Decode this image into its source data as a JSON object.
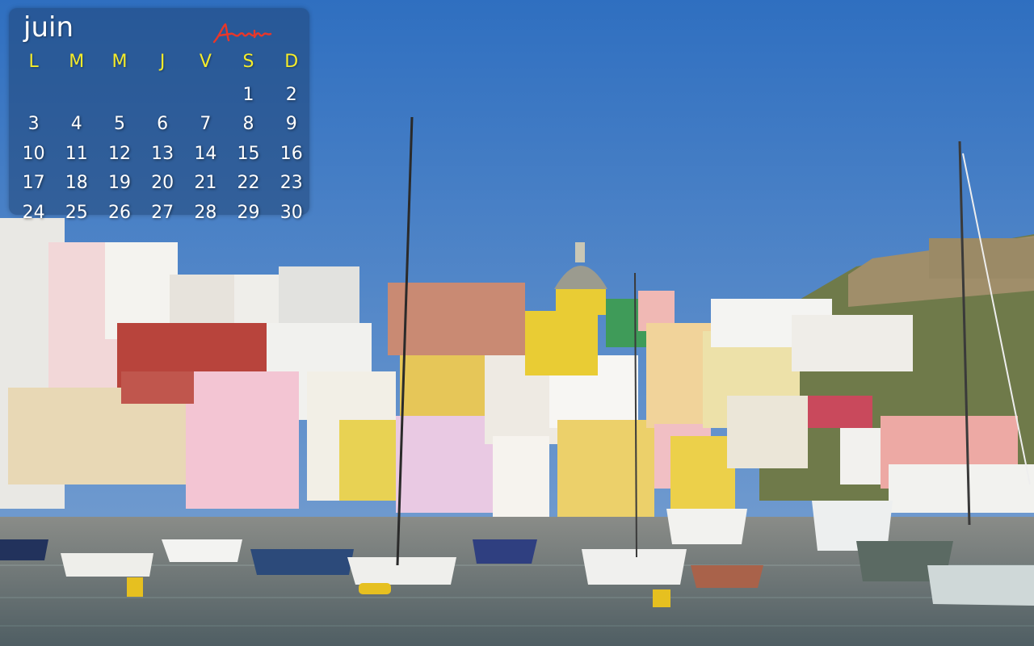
{
  "calendar": {
    "month": "juin",
    "signature": "Antoine",
    "weekdays": [
      "L",
      "M",
      "M",
      "J",
      "V",
      "S",
      "D"
    ],
    "weeks": [
      [
        "",
        "",
        "",
        "",
        "",
        "1",
        "2"
      ],
      [
        "3",
        "4",
        "5",
        "6",
        "7",
        "8",
        "9"
      ],
      [
        "10",
        "11",
        "12",
        "13",
        "14",
        "15",
        "16"
      ],
      [
        "17",
        "18",
        "19",
        "20",
        "21",
        "22",
        "23"
      ],
      [
        "24",
        "25",
        "26",
        "27",
        "28",
        "29",
        "30"
      ]
    ]
  },
  "colors": {
    "weekday_header": "#f4ec2a",
    "day_number": "#ffffff",
    "signature": "#e8372a",
    "sky": "#3a78c2",
    "water": "#5f6f70"
  },
  "wallpaper": {
    "scene": "harbor-village-photo"
  }
}
